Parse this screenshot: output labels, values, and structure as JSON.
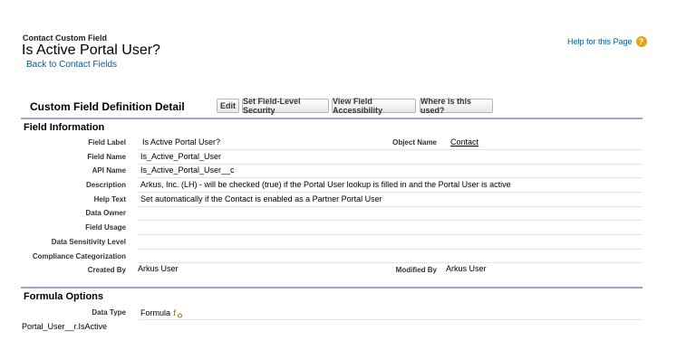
{
  "header": {
    "breadcrumb": "Contact Custom Field",
    "title": "Is Active Portal User?",
    "back_link": "Back to Contact Fields",
    "help_link": "Help for this Page",
    "help_icon": "?"
  },
  "detail": {
    "section_title": "Custom Field Definition Detail",
    "buttons": {
      "edit": "Edit",
      "fls": "Set Field-Level Security",
      "accessibility": "View Field Accessibility",
      "where_used": "Where is this used?"
    }
  },
  "field_info": {
    "heading": "Field Information",
    "field_label": {
      "label": "Field Label",
      "value": "Is Active Portal User?"
    },
    "object_name": {
      "label": "Object Name",
      "value": "Contact"
    },
    "field_name": {
      "label": "Field Name",
      "value": "Is_Active_Portal_User"
    },
    "api_name": {
      "label": "API Name",
      "value": "Is_Active_Portal_User__c"
    },
    "description": {
      "label": "Description",
      "value": "Arkus, Inc. (LH) - will be checked (true) if the Portal User lookup is filled in and the Portal User is active"
    },
    "help_text": {
      "label": "Help Text",
      "value": "Set automatically if the Contact is enabled as a Partner Portal User"
    },
    "data_owner": {
      "label": "Data Owner",
      "value": ""
    },
    "field_usage": {
      "label": "Field Usage",
      "value": ""
    },
    "data_sensitivity": {
      "label": "Data Sensitivity Level",
      "value": ""
    },
    "compliance": {
      "label": "Compliance Categorization",
      "value": ""
    },
    "created_by": {
      "label": "Created By",
      "value": "Arkus User"
    },
    "modified_by": {
      "label": "Modified By",
      "value": "Arkus User"
    }
  },
  "formula_options": {
    "heading": "Formula Options",
    "data_type": {
      "label": "Data Type",
      "value": "Formula"
    },
    "formula_text": "Portal_User__r.IsActive"
  },
  "colors": {
    "link": "#015ba7",
    "rule": "#99a7d1",
    "help_icon": "#e8a317"
  }
}
